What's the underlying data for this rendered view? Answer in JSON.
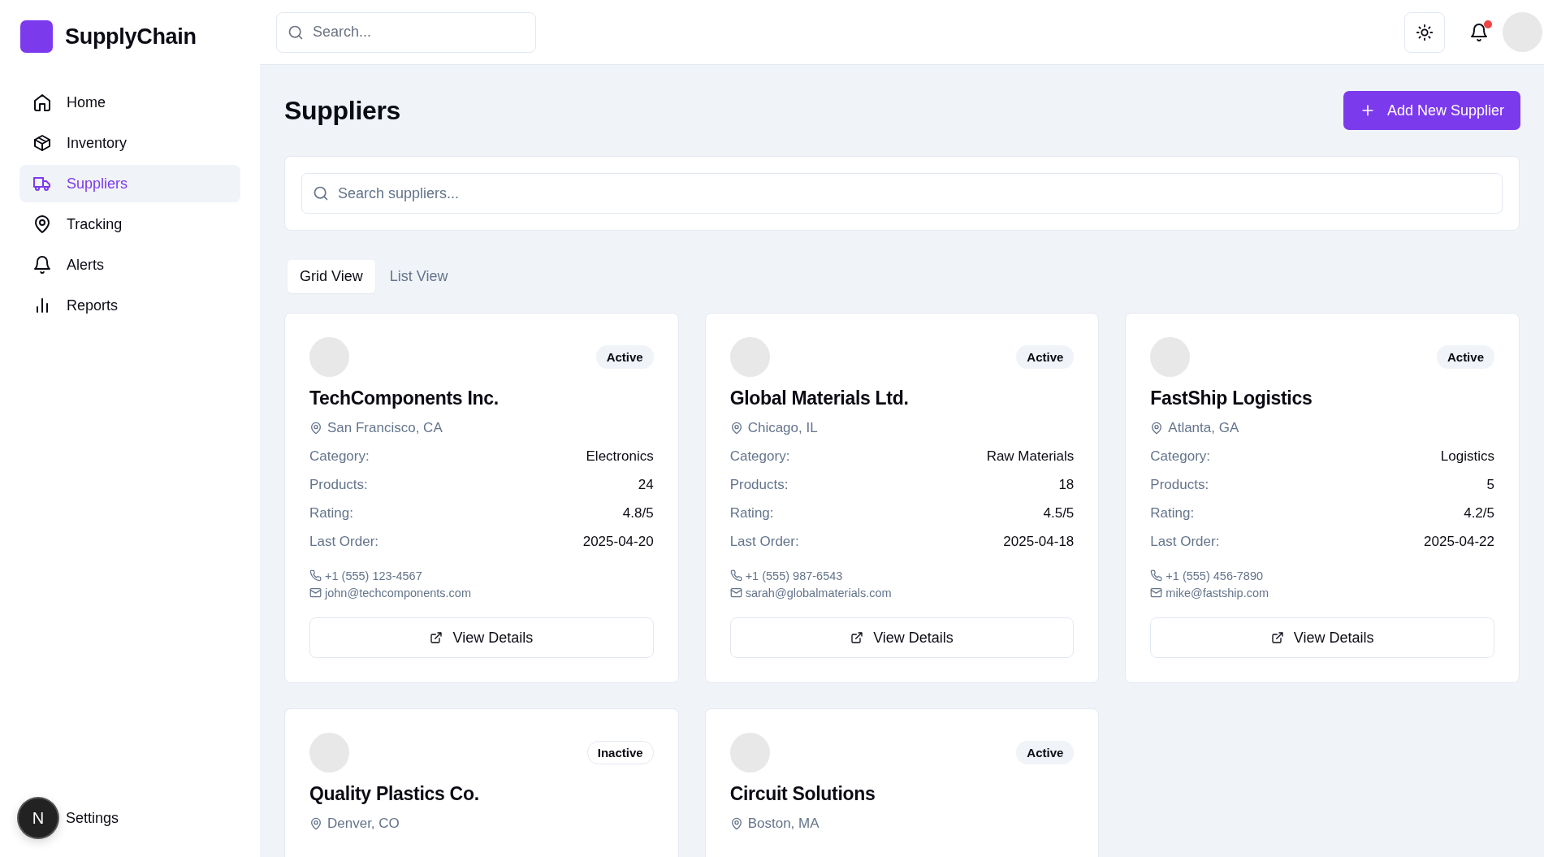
{
  "brand": {
    "name": "SupplyChain"
  },
  "header": {
    "search": {
      "placeholder": "Search..."
    },
    "notifications": {
      "unread": true
    }
  },
  "sidebar": {
    "items": [
      {
        "label": "Home",
        "selected": false
      },
      {
        "label": "Inventory",
        "selected": false
      },
      {
        "label": "Suppliers",
        "selected": true
      },
      {
        "label": "Tracking",
        "selected": false
      },
      {
        "label": "Alerts",
        "selected": false
      },
      {
        "label": "Reports",
        "selected": false
      }
    ],
    "footer": {
      "badge": "N",
      "label": "Settings"
    }
  },
  "page": {
    "title": "Suppliers",
    "add_button": "Add New Supplier",
    "search": {
      "placeholder": "Search suppliers..."
    },
    "view_tabs": [
      {
        "label": "Grid View",
        "selected": true
      },
      {
        "label": "List View",
        "selected": false
      }
    ]
  },
  "suppliers": [
    {
      "name": "TechComponents Inc.",
      "location": "San Francisco, CA",
      "status": "Active",
      "active": true,
      "details": [
        {
          "label": "Category:",
          "value": "Electronics"
        },
        {
          "label": "Products:",
          "value": "24"
        },
        {
          "label": "Rating:",
          "value": "4.8/5"
        },
        {
          "label": "Last Order:",
          "value": "2025-04-20"
        }
      ],
      "phone": "+1 (555) 123-4567",
      "email": "john@techcomponents.com",
      "button": "View Details"
    },
    {
      "name": "Global Materials Ltd.",
      "location": "Chicago, IL",
      "status": "Active",
      "active": true,
      "details": [
        {
          "label": "Category:",
          "value": "Raw Materials"
        },
        {
          "label": "Products:",
          "value": "18"
        },
        {
          "label": "Rating:",
          "value": "4.5/5"
        },
        {
          "label": "Last Order:",
          "value": "2025-04-18"
        }
      ],
      "phone": "+1 (555) 987-6543",
      "email": "sarah@globalmaterials.com",
      "button": "View Details"
    },
    {
      "name": "FastShip Logistics",
      "location": "Atlanta, GA",
      "status": "Active",
      "active": true,
      "details": [
        {
          "label": "Category:",
          "value": "Logistics"
        },
        {
          "label": "Products:",
          "value": "5"
        },
        {
          "label": "Rating:",
          "value": "4.2/5"
        },
        {
          "label": "Last Order:",
          "value": "2025-04-22"
        }
      ],
      "phone": "+1 (555) 456-7890",
      "email": "mike@fastship.com",
      "button": "View Details"
    },
    {
      "name": "Quality Plastics Co.",
      "location": "Denver, CO",
      "status": "Inactive",
      "active": false
    },
    {
      "name": "Circuit Solutions",
      "location": "Boston, MA",
      "status": "Active",
      "active": true
    }
  ]
}
